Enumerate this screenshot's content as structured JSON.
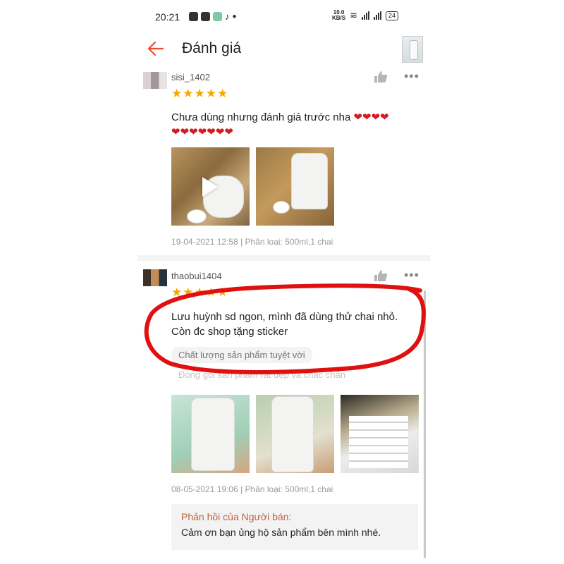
{
  "status_bar": {
    "time": "20:21",
    "speed_top": "10.0",
    "speed_bottom": "KB/S",
    "battery": "24"
  },
  "header": {
    "title": "Đánh giá",
    "back_icon": "arrow-left-icon"
  },
  "colors": {
    "accent": "#ee4d2d",
    "star": "#f6a700",
    "heart": "#d31b22",
    "annotation": "#e01010",
    "seller_title": "#c0623d"
  },
  "reviews": [
    {
      "username": "sisi_1402",
      "rating": 5,
      "stars": "★★★★★",
      "comment_line1": "Chưa dùng nhưng đánh giá trước nha",
      "hearts_line1": "❤❤❤❤",
      "hearts_line2": "❤❤❤❤❤❤❤",
      "meta": "19-04-2021 12:58 | Phân loại: 500ml,1 chai"
    },
    {
      "username": "thaobui1404",
      "rating": 5,
      "stars": "★★★★★",
      "comment_line1": "Lưu huỳnh sd ngon, mình đã dùng thử chai nhỏ.",
      "comment_line2": "Còn đc shop tặng sticker",
      "tag1": "Chất lượng sản phẩm tuyệt vời",
      "tag2": "Đóng gói sản phẩm rất đẹp và chắc chắn",
      "meta": "08-05-2021 19:06 | Phân loại: 500ml,1 chai",
      "seller_reply_title": "Phản hồi của Người bán:",
      "seller_reply_text": "Cảm ơn bạn ủng hộ sản phẩm bên mình nhé."
    }
  ]
}
